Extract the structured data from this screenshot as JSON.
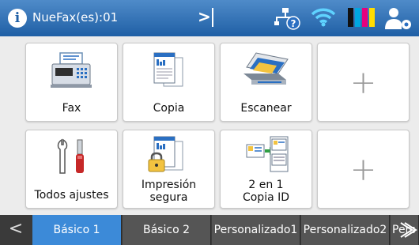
{
  "status": {
    "info_icon": "i",
    "fax_text": "NueFax(es):01",
    "chevron": ">"
  },
  "tiles": [
    {
      "label": "Fax",
      "icon": "fax-icon"
    },
    {
      "label": "Copia",
      "icon": "copy-icon"
    },
    {
      "label": "Escanear",
      "icon": "scanner-icon"
    },
    {
      "label": "+",
      "icon": "plus-icon"
    },
    {
      "label": "Todos ajustes",
      "icon": "tools-icon"
    },
    {
      "label_line1": "Impresión",
      "label_line2": "segura",
      "icon": "secure-print-icon"
    },
    {
      "label_line1": "2 en 1",
      "label_line2": "Copia ID",
      "icon": "id-copy-icon"
    },
    {
      "label": "+",
      "icon": "plus-icon"
    }
  ],
  "tabs": [
    {
      "label": "Básico 1",
      "active": true
    },
    {
      "label": "Básico 2",
      "active": false
    },
    {
      "label": "Personalizado1",
      "active": false
    },
    {
      "label": "Personalizado2",
      "active": false
    },
    {
      "label": "Pers",
      "active": false
    }
  ],
  "nav": {
    "prev": "<"
  },
  "colors": {
    "accent": "#3c8ad8",
    "topbar": "#1f5fa5",
    "ink_black": "#111111",
    "ink_cyan": "#00a7e1",
    "ink_magenta": "#e6007e",
    "ink_yellow": "#ffdd00"
  }
}
